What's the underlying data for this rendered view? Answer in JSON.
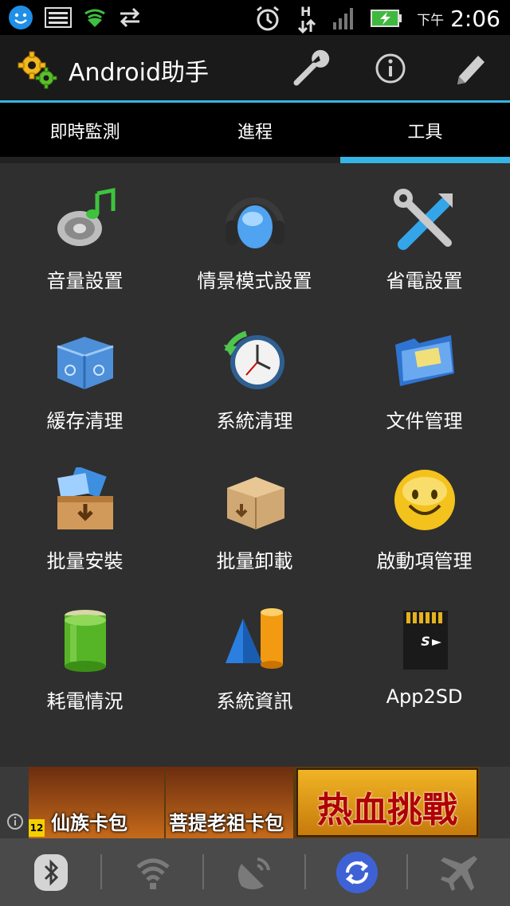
{
  "status_bar": {
    "ampm": "下午",
    "time": "2:06",
    "icons": [
      "face-icon",
      "image-icon",
      "shield-icon",
      "sync-arrows-icon",
      "alarm-icon",
      "hplus-network-icon",
      "signal-icon",
      "battery-charging-icon"
    ]
  },
  "app": {
    "title": "Android助手",
    "actions": [
      "wrench-icon",
      "info-icon",
      "pencil-icon"
    ]
  },
  "tabs": [
    {
      "label": "即時監測",
      "active": false
    },
    {
      "label": "進程",
      "active": false
    },
    {
      "label": "工具",
      "active": true
    }
  ],
  "tools": [
    {
      "label": "音量設置",
      "icon": "speaker-music-icon"
    },
    {
      "label": "情景模式設置",
      "icon": "headphones-icon"
    },
    {
      "label": "省電設置",
      "icon": "tools-icon"
    },
    {
      "label": "緩存清理",
      "icon": "recycle-box-icon"
    },
    {
      "label": "系統清理",
      "icon": "clock-icon"
    },
    {
      "label": "文件管理",
      "icon": "folder-icon"
    },
    {
      "label": "批量安裝",
      "icon": "install-box-icon"
    },
    {
      "label": "批量卸載",
      "icon": "uninstall-box-icon"
    },
    {
      "label": "啟動項管理",
      "icon": "smiley-icon"
    },
    {
      "label": "耗電情況",
      "icon": "battery-icon"
    },
    {
      "label": "系統資訊",
      "icon": "shapes-icon"
    },
    {
      "label": "App2SD",
      "icon": "sd-card-icon"
    }
  ],
  "ad": {
    "card1": "仙族卡包",
    "card2": "菩提老祖卡包",
    "headline": "热血挑戰",
    "rating": "12"
  },
  "toggles": [
    "bluetooth-icon",
    "wifi-icon",
    "gps-icon",
    "sync-icon",
    "airplane-icon"
  ],
  "colors": {
    "accent": "#33b5e5",
    "sync_active": "#3e62d6"
  }
}
